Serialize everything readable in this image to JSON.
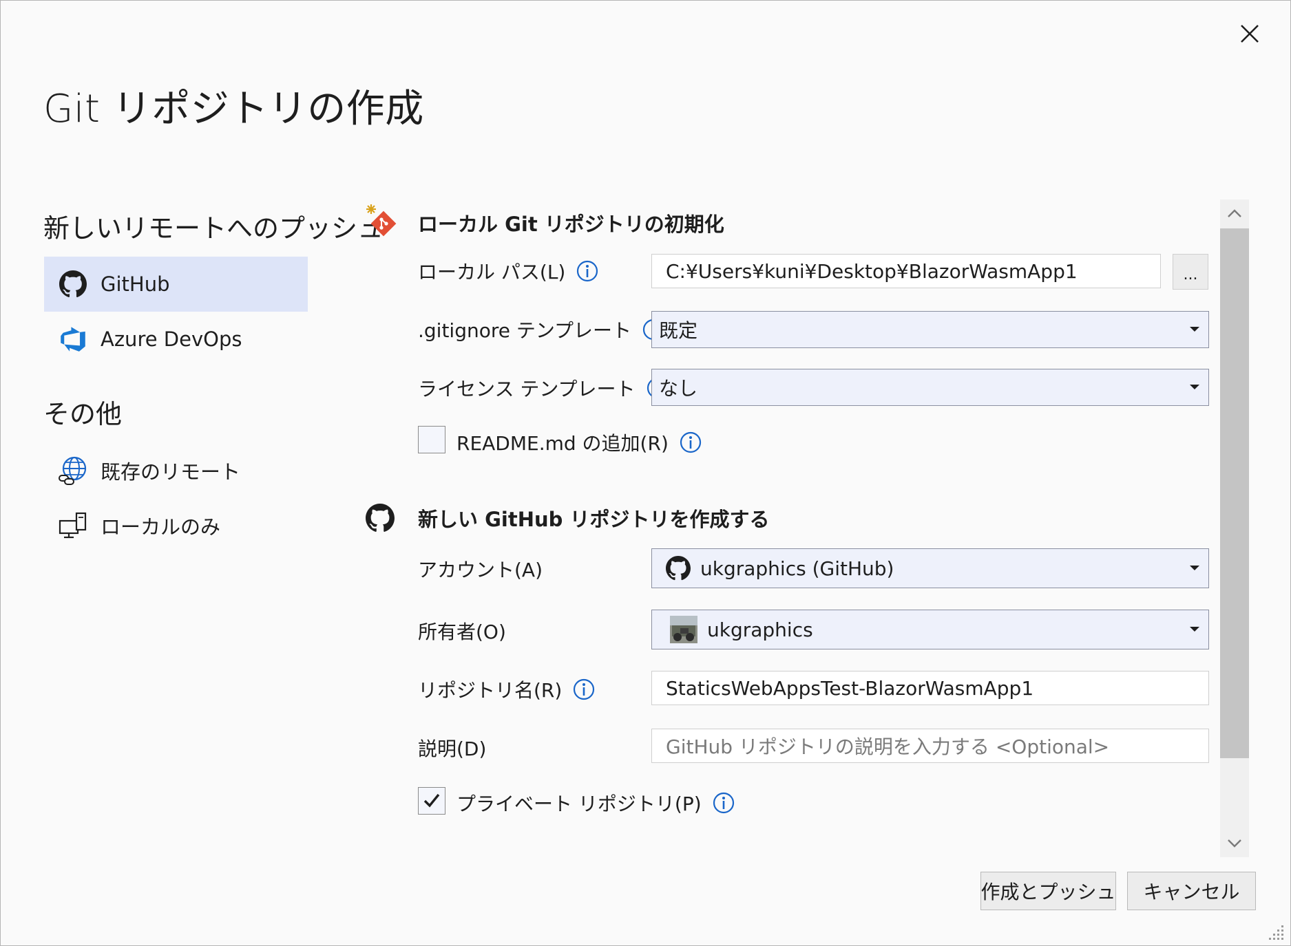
{
  "dialog": {
    "title": "Git リポジトリの作成"
  },
  "sidebar": {
    "push_heading": "新しいリモートへのプッシュ",
    "push_items": [
      {
        "label": "GitHub",
        "icon": "github-icon",
        "selected": true
      },
      {
        "label": "Azure DevOps",
        "icon": "azure-devops-icon",
        "selected": false
      }
    ],
    "other_heading": "その他",
    "other_items": [
      {
        "label": "既存のリモート",
        "icon": "globe-link-icon"
      },
      {
        "label": "ローカルのみ",
        "icon": "local-computer-icon"
      }
    ]
  },
  "local_repo": {
    "title": "ローカル Git リポジトリの初期化",
    "icon": "git-init-icon",
    "local_path_label": "ローカル パス(L)",
    "local_path_value": "C:¥Users¥kuni¥Desktop¥BlazorWasmApp1",
    "browse_label": "...",
    "gitignore_label": ".gitignore テンプレート",
    "gitignore_value": "既定",
    "license_label": "ライセンス テンプレート",
    "license_value": "なし",
    "readme_label": "README.md の追加(R)",
    "readme_checked": false
  },
  "github_repo": {
    "title": "新しい GitHub リポジトリを作成する",
    "icon": "github-icon",
    "account_label": "アカウント(A)",
    "account_value": "ukgraphics (GitHub)",
    "owner_label": "所有者(O)",
    "owner_value": "ukgraphics",
    "repo_name_label": "リポジトリ名(R)",
    "repo_name_value": "StaticsWebAppsTest-BlazorWasmApp1",
    "description_label": "説明(D)",
    "description_placeholder": "GitHub リポジトリの説明を入力する <Optional>",
    "private_label": "プライベート リポジトリ(P)",
    "private_checked": true
  },
  "footer": {
    "create_push_label": "作成とプッシュ",
    "cancel_label": "キャンセル"
  },
  "colors": {
    "selected_bg": "#dde4f8",
    "info_blue": "#1a66c9",
    "git_red": "#e24f35",
    "azure_blue": "#1a7ad4"
  }
}
